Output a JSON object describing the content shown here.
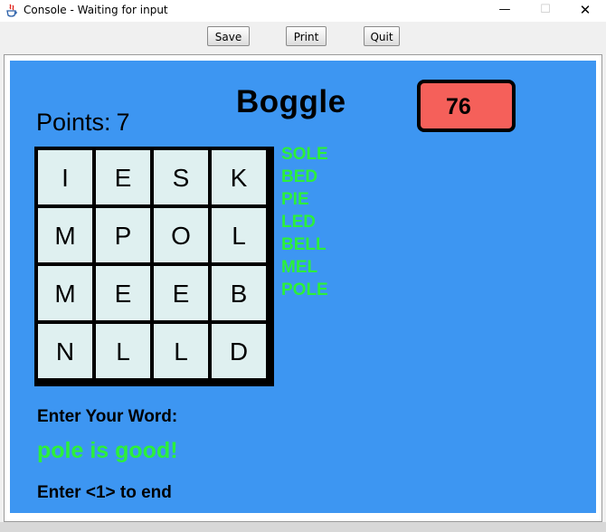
{
  "window": {
    "title": "Console - Waiting for input",
    "minimize": "—",
    "maximize": "☐",
    "close": "✕"
  },
  "toolbar": {
    "save_label": "Save",
    "print_label": "Print",
    "quit_label": "Quit"
  },
  "game": {
    "title": "Boggle",
    "timer": "76",
    "points_label": "Points:",
    "points_value": "7",
    "board": [
      [
        "I",
        "E",
        "S",
        "K"
      ],
      [
        "M",
        "P",
        "O",
        "L"
      ],
      [
        "M",
        "E",
        "E",
        "B"
      ],
      [
        "N",
        "L",
        "L",
        "D"
      ]
    ],
    "found_words": [
      "SOLE",
      "BED",
      "PIE",
      "LED",
      "BELL",
      "MEL",
      "POLE"
    ],
    "prompt": "Enter Your Word:",
    "feedback": "pole is good!",
    "end_hint": "Enter <1> to end"
  },
  "colors": {
    "canvas": "#3d96f2",
    "timer_box": "#f5605a",
    "found_words": "#2cf03a",
    "cell": "#dff0f0"
  }
}
